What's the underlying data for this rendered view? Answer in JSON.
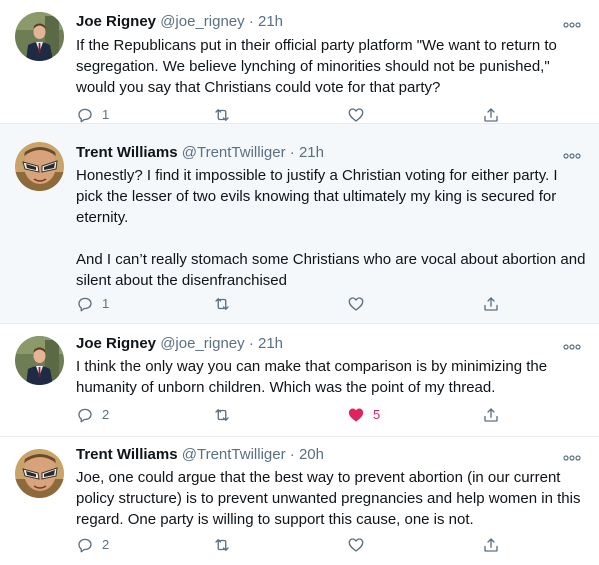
{
  "tweets": [
    {
      "name": "Joe Rigney",
      "handle": "@joe_rigney",
      "time": "21h",
      "paragraphs": [
        "If the Republicans put in their official party platform \"We want to return to segregation. We believe lynching of minorities should not be punished,\" would you say that Christians could vote for that party?"
      ],
      "replies": "1",
      "likes": "",
      "liked": false,
      "avatar_icon": "user-avatar-suit"
    },
    {
      "name": "Trent Williams",
      "handle": "@TrentTwilliger",
      "time": "21h",
      "paragraphs": [
        "Honestly? I find it impossible to justify a Christian voting for either party. I pick the lesser of two evils knowing that ultimately my king is secured for eternity.",
        "And I can’t really stomach some Christians who are vocal about abortion and silent about the disenfranchised"
      ],
      "replies": "1",
      "likes": "",
      "liked": false,
      "avatar_icon": "user-avatar-sunglasses"
    },
    {
      "name": "Joe Rigney",
      "handle": "@joe_rigney",
      "time": "21h",
      "paragraphs": [
        "I think the only way you can make that comparison is by minimizing the humanity of unborn children. Which was the point of my thread."
      ],
      "replies": "2",
      "likes": "5",
      "liked": true,
      "avatar_icon": "user-avatar-suit"
    },
    {
      "name": "Trent Williams",
      "handle": "@TrentTwilliger",
      "time": "20h",
      "paragraphs": [
        "Joe, one could argue that the best way to prevent abortion (in our current policy structure) is to prevent unwanted pregnancies and help women in this regard. One party is willing to support this cause, one is not."
      ],
      "replies": "2",
      "likes": "",
      "liked": false,
      "avatar_icon": "user-avatar-sunglasses"
    }
  ],
  "colors": {
    "text": "#0f1419",
    "secondary": "#5b7083",
    "like": "#e0245e",
    "divider": "#e6ecf0",
    "highlight_bg": "#f5f8fa"
  }
}
